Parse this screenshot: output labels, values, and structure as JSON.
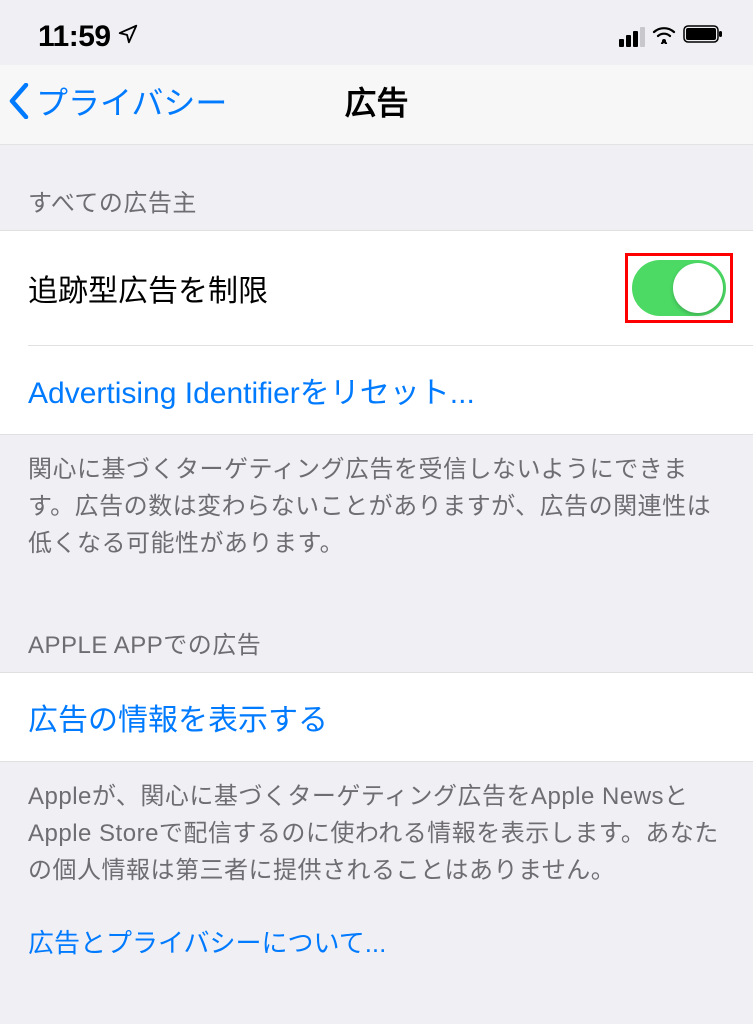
{
  "statusBar": {
    "time": "11:59"
  },
  "nav": {
    "backLabel": "プライバシー",
    "title": "広告"
  },
  "section1": {
    "header": "すべての広告主",
    "limitAdTrackingLabel": "追跡型広告を制限",
    "limitAdTrackingOn": true,
    "resetIdentifierLabel": "Advertising Identifierをリセット...",
    "footer": "関心に基づくターゲティング広告を受信しないようにできます。広告の数は変わらないことがありますが、広告の関連性は低くなる可能性があります。"
  },
  "section2": {
    "header": "APPLE APPでの広告",
    "viewAdInfoLabel": "広告の情報を表示する",
    "footer": "Appleが、関心に基づくターゲティング広告をApple NewsとApple Storeで配信するのに使われる情報を表示します。あなたの個人情報は第三者に提供されることはありません。",
    "aboutLink": "広告とプライバシーについて..."
  }
}
